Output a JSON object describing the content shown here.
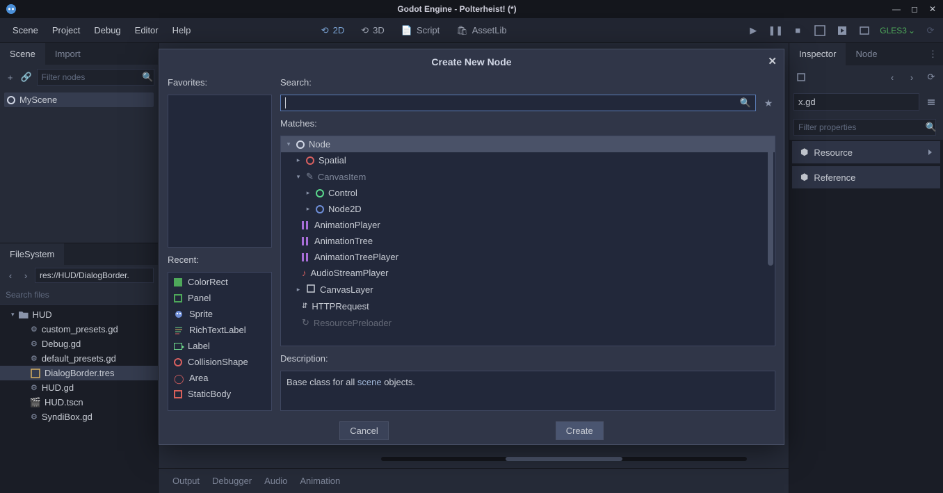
{
  "window_title": "Godot Engine - Polterheist! (*)",
  "menubar": [
    "Scene",
    "Project",
    "Debug",
    "Editor",
    "Help"
  ],
  "view_toggles": [
    {
      "label": "2D",
      "active": true,
      "icon": "sync"
    },
    {
      "label": "3D",
      "active": false,
      "icon": "sync"
    },
    {
      "label": "Script",
      "active": false,
      "icon": "script"
    },
    {
      "label": "AssetLib",
      "active": false,
      "icon": "bag"
    }
  ],
  "gles_label": "GLES3",
  "left_tabs": {
    "scene": "Scene",
    "import": "Import"
  },
  "filter_placeholder": "Filter nodes",
  "scene_tree": [
    {
      "name": "MyScene"
    }
  ],
  "filesystem_tab": "FileSystem",
  "fs_path": "res://HUD/DialogBorder.",
  "fs_search_placeholder": "Search files",
  "fs_tree": {
    "folder": "HUD",
    "items": [
      {
        "name": "custom_presets.gd",
        "icon": "gear"
      },
      {
        "name": "Debug.gd",
        "icon": "gear"
      },
      {
        "name": "default_presets.gd",
        "icon": "gear"
      },
      {
        "name": "DialogBorder.tres",
        "icon": "style",
        "selected": true
      },
      {
        "name": "HUD.gd",
        "icon": "gear"
      },
      {
        "name": "HUD.tscn",
        "icon": "scene"
      },
      {
        "name": "SyndiBox.gd",
        "icon": "gear"
      }
    ]
  },
  "right_tabs": {
    "inspector": "Inspector",
    "node": "Node"
  },
  "inspector_file": "x.gd",
  "inspector_filter_placeholder": "Filter properties",
  "inspector_groups": [
    "Resource",
    "Reference"
  ],
  "bottom_tabs": [
    "Output",
    "Debugger",
    "Audio",
    "Animation"
  ],
  "modal": {
    "title": "Create New Node",
    "favorites_label": "Favorites:",
    "recent_label": "Recent:",
    "search_label": "Search:",
    "matches_label": "Matches:",
    "description_label": "Description:",
    "search_value": "",
    "recent": [
      {
        "name": "ColorRect",
        "icon": "green-fill"
      },
      {
        "name": "Panel",
        "icon": "green-outline"
      },
      {
        "name": "Sprite",
        "icon": "sprite"
      },
      {
        "name": "RichTextLabel",
        "icon": "richtext"
      },
      {
        "name": "Label",
        "icon": "label"
      },
      {
        "name": "CollisionShape",
        "icon": "collision"
      },
      {
        "name": "Area",
        "icon": "area"
      },
      {
        "name": "StaticBody",
        "icon": "static"
      }
    ],
    "matches": [
      {
        "name": "Node",
        "depth": 0,
        "expand": "down",
        "icon": "white-ring",
        "selected": true
      },
      {
        "name": "Spatial",
        "depth": 1,
        "expand": "right",
        "icon": "red-ring"
      },
      {
        "name": "CanvasItem",
        "depth": 1,
        "expand": "down",
        "icon": "canvasitem",
        "dim": true
      },
      {
        "name": "Control",
        "depth": 2,
        "expand": "right",
        "icon": "green-ring"
      },
      {
        "name": "Node2D",
        "depth": 2,
        "expand": "right",
        "icon": "blue-ring"
      },
      {
        "name": "AnimationPlayer",
        "depth": 1,
        "expand": "none",
        "icon": "anim"
      },
      {
        "name": "AnimationTree",
        "depth": 1,
        "expand": "none",
        "icon": "anim"
      },
      {
        "name": "AnimationTreePlayer",
        "depth": 1,
        "expand": "none",
        "icon": "anim"
      },
      {
        "name": "AudioStreamPlayer",
        "depth": 1,
        "expand": "none",
        "icon": "audio"
      },
      {
        "name": "CanvasLayer",
        "depth": 1,
        "expand": "right",
        "icon": "canvas"
      },
      {
        "name": "HTTPRequest",
        "depth": 1,
        "expand": "none",
        "icon": "http"
      },
      {
        "name": "ResourcePreloader",
        "depth": 1,
        "expand": "none",
        "icon": "preload",
        "cut": true
      }
    ],
    "description_pre": "Base class for all ",
    "description_kw": "scene",
    "description_post": " objects.",
    "cancel": "Cancel",
    "create": "Create"
  }
}
